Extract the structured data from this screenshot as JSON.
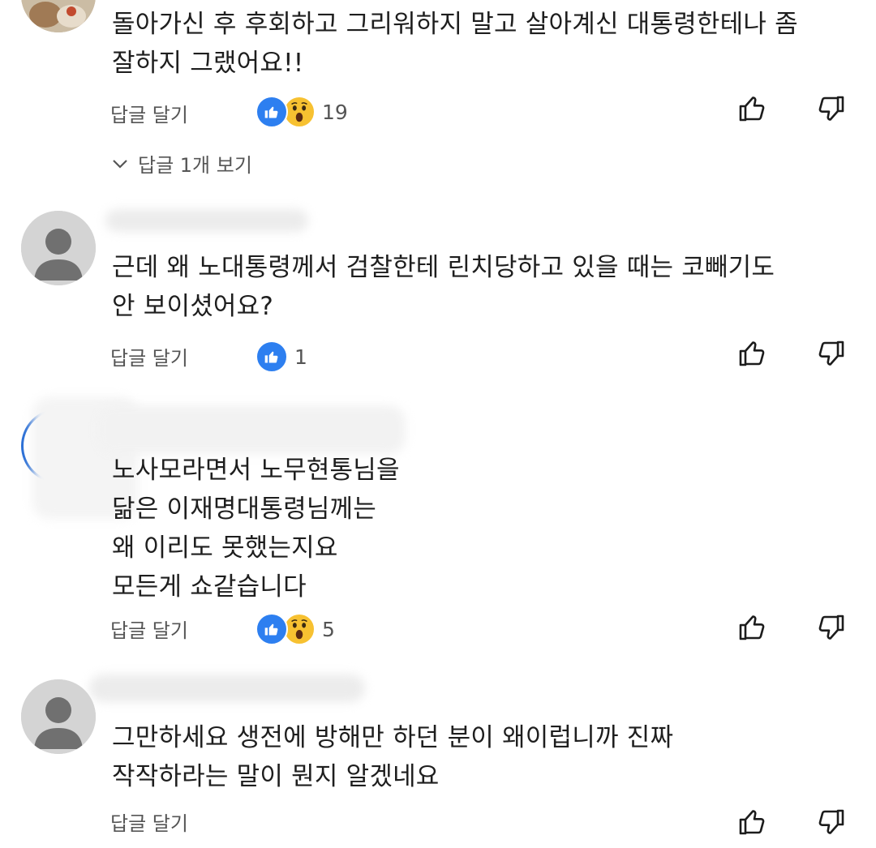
{
  "comments": [
    {
      "text": "돌아가신 후 후회하고 그리워하지 말고 살아계신 대통령한테나 좀\n잘하지 그랬어요!!",
      "reply_label": "답글 달기",
      "reactions": [
        "like",
        "wow"
      ],
      "reaction_count": "19",
      "replies_toggle": "답글 1개 보기"
    },
    {
      "text": "근데 왜 노대통령께서 검찰한테 린치당하고 있을 때는 코빼기도\n안 보이셨어요?",
      "reply_label": "답글 달기",
      "reactions": [
        "like"
      ],
      "reaction_count": "1"
    },
    {
      "text": "노사모라면서 노무현통님을\n닮은 이재명대통령님께는\n왜 이리도 못했는지요\n모든게 쇼같습니다",
      "reply_label": "답글 달기",
      "reactions": [
        "like",
        "wow"
      ],
      "reaction_count": "5"
    },
    {
      "text": "그만하세요 생전에 방해만 하던 분이 왜이럽니까 진짜\n작작하라는 말이 뭔지 알겠네요",
      "reply_label": "답글 달기",
      "reactions": []
    }
  ],
  "colors": {
    "like_blue": "#2d7ff0",
    "wow_yellow": "#f7c131",
    "muted_text": "#555555"
  },
  "icons": {
    "like": "thumbs-up-icon",
    "dislike": "thumbs-down-icon",
    "expand": "chevron-down-icon"
  }
}
